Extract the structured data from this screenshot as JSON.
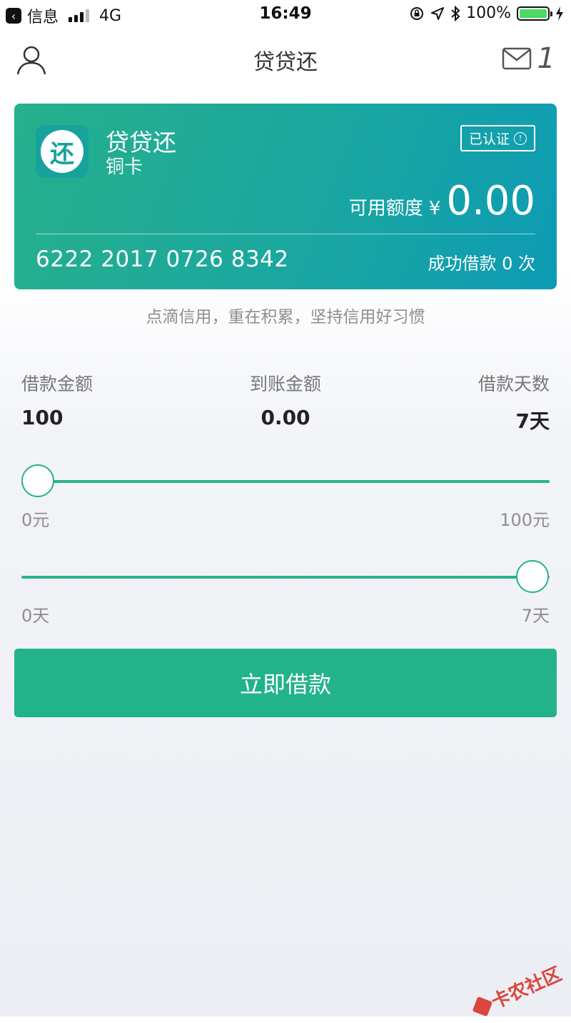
{
  "status_bar": {
    "back_app": "信息",
    "network": "4G",
    "time": "16:49",
    "battery": "100%",
    "battery_level": 1.0
  },
  "nav": {
    "title": "贷贷还",
    "mail_count": "1"
  },
  "card": {
    "logo_char": "还",
    "name": "贷贷还",
    "tier": "铜卡",
    "badge": "已认证",
    "badge_icon": "!",
    "credit_label": "可用额度",
    "currency": "¥",
    "credit_amount": "0.00",
    "card_number": "6222 2017 0726 8342",
    "success_text": "成功借款 0 次"
  },
  "slogan": "点滴信用，重在积累，坚持信用好习惯",
  "stats": {
    "loan_amount_label": "借款金额",
    "loan_amount_value": "100",
    "received_label": "到账金额",
    "received_value": "0.00",
    "days_label": "借款天数",
    "days_value": "7天"
  },
  "amount_slider": {
    "min_label": "0元",
    "max_label": "100元",
    "level": 0.0
  },
  "days_slider": {
    "min_label": "0天",
    "max_label": "7天",
    "level": 1.0
  },
  "submit_label": "立即借款",
  "watermark": "卡农社区",
  "colors": {
    "accent": "#22b38a",
    "card_start": "#26b08c",
    "card_end": "#0d9bb5"
  }
}
